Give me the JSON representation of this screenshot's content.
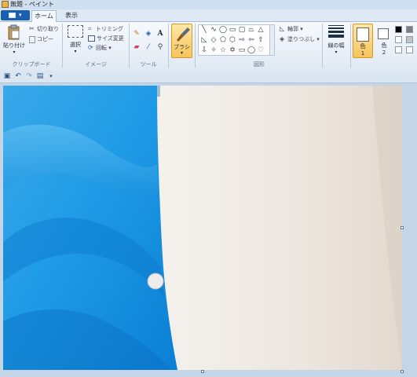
{
  "window": {
    "title": "無題 - ペイント"
  },
  "tabs": {
    "home": "ホーム",
    "view": "表示"
  },
  "clipboard": {
    "paste": "貼り付け",
    "cut": "切り取り",
    "copy": "コピー",
    "group": "クリップボード"
  },
  "image": {
    "select": "選択",
    "crop": "トリミング",
    "resize": "サイズ変更",
    "rotate": "回転",
    "group": "イメージ"
  },
  "tools": {
    "group": "ツール"
  },
  "brushes": {
    "label": "ブラシ"
  },
  "shapes": {
    "outline": "輪郭",
    "fill": "塗りつぶし",
    "group": "図形"
  },
  "size": {
    "label": "線の幅"
  },
  "colors": {
    "color1": "色",
    "color1_num": "1",
    "color2": "色",
    "color2_num": "2"
  },
  "icons": [
    "paste-icon",
    "cut-icon",
    "copy-icon",
    "select-icon",
    "crop-icon",
    "resize-icon",
    "rotate-icon",
    "pencil-icon",
    "fill-icon",
    "text-icon",
    "eraser-icon",
    "color-picker-icon",
    "magnifier-icon",
    "brush-icon",
    "save-icon",
    "undo-icon",
    "redo-icon"
  ],
  "palette": [
    "#000000",
    "#7f7f7f",
    "#ffffff",
    "#c3c3c3",
    "#ffffff",
    "#ffffff"
  ],
  "accent": "#f7c45a"
}
